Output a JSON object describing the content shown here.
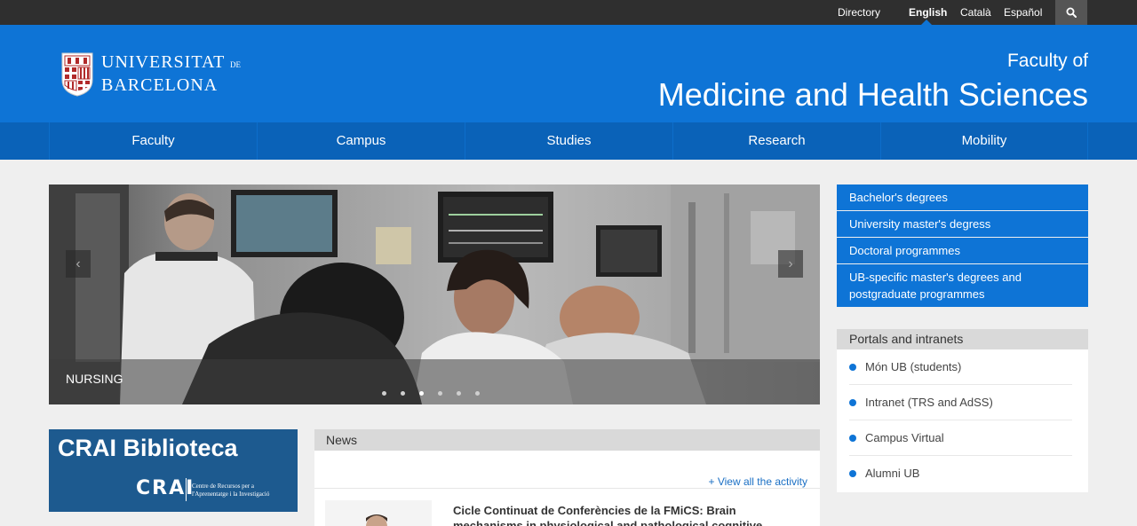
{
  "topbar": {
    "directory": "Directory",
    "languages": [
      "English",
      "Català",
      "Español"
    ],
    "active_language": "English",
    "search_icon": "search-icon"
  },
  "header": {
    "logo_line1": "UNIVERSITAT",
    "logo_de": "DE",
    "logo_line2": "BARCELONA",
    "faculty_of": "Faculty of",
    "faculty_name": "Medicine and Health Sciences"
  },
  "nav": {
    "items": [
      "Faculty",
      "Campus",
      "Studies",
      "Research",
      "Mobility"
    ]
  },
  "slider": {
    "caption": "NURSING",
    "prev_icon": "chevron-left-icon",
    "next_icon": "chevron-right-icon",
    "slide_count": 6,
    "active_slide": 3
  },
  "degrees": {
    "items": [
      "Bachelor's degrees",
      "University master's degress",
      "Doctoral programmes",
      "UB-specific master's degrees and postgraduate programmes"
    ]
  },
  "portals": {
    "title": "Portals and intranets",
    "items": [
      "Món UB (students)",
      "Intranet (TRS and AdSS)",
      "Campus Virtual",
      "Alumni UB"
    ]
  },
  "crai": {
    "title": "CRAI Biblioteca",
    "logo_text": "CRAI",
    "subtitle_line1": "Centre de Recursos per a",
    "subtitle_line2": "l'Aprenentatge i la Investigació"
  },
  "news": {
    "title": "News",
    "view_all": "+ View all the activity",
    "item_title": "Cicle Continuat de Conferències de la FMiCS: Brain mechanisms in physiological and pathological cognitive"
  },
  "colors": {
    "brand_blue": "#0e74d6",
    "nav_blue": "#0a62b8",
    "topbar": "#2f2f2f",
    "crai_blue": "#1d5a8f"
  }
}
